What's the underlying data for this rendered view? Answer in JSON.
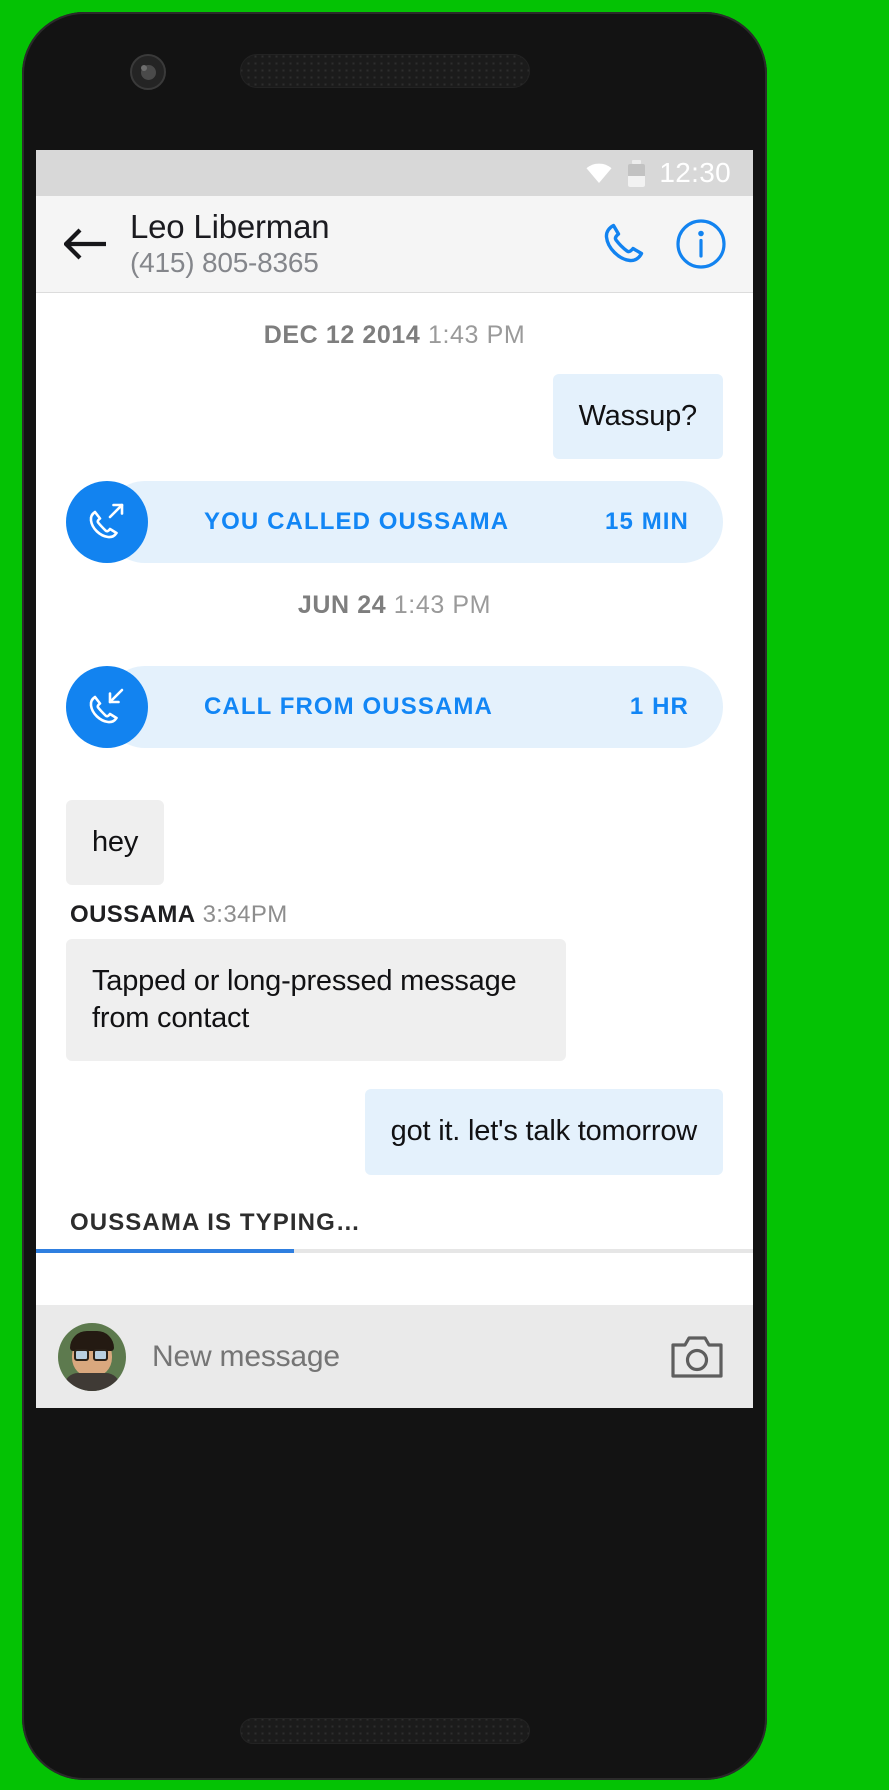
{
  "status_bar": {
    "time": "12:30",
    "wifi_icon": "wifi-icon",
    "battery_icon": "battery-icon"
  },
  "header": {
    "back_icon": "back-arrow-icon",
    "contact_name": "Leo Liberman",
    "contact_phone": "(415) 805-8365",
    "call_icon": "phone-call-icon",
    "info_icon": "info-circle-icon"
  },
  "thread": {
    "separator_1": {
      "date": "DEC 12 2014",
      "time": "1:43 PM"
    },
    "message_1": {
      "text": "Wassup?",
      "direction": "outgoing"
    },
    "call_1": {
      "label": "YOU CALLED OUSSAMA",
      "duration": "15 MIN",
      "icon": "call-outgoing-icon",
      "direction": "outgoing"
    },
    "separator_2": {
      "date": "JUN 24",
      "time": "1:43 PM"
    },
    "call_2": {
      "label": "CALL FROM OUSSAMA",
      "duration": "1 HR",
      "icon": "call-incoming-icon",
      "direction": "incoming"
    },
    "message_2": {
      "text": "hey",
      "direction": "incoming"
    },
    "message_meta": {
      "sender": "OUSSAMA",
      "time": "3:34PM"
    },
    "message_3": {
      "text": "Tapped or long-pressed message from contact",
      "direction": "incoming"
    },
    "message_4": {
      "text": "got it. let's talk tomorrow",
      "direction": "outgoing"
    },
    "typing_indicator": "OUSSAMA IS TYPING…"
  },
  "composer": {
    "avatar": "user-avatar",
    "placeholder": "New message",
    "value": "",
    "camera_icon": "camera-icon"
  },
  "colors": {
    "accent_blue": "#1283f0",
    "outgoing_bubble": "#e4f1fc",
    "incoming_bubble": "#efefef",
    "background": "#00c400",
    "device": "#131313"
  }
}
